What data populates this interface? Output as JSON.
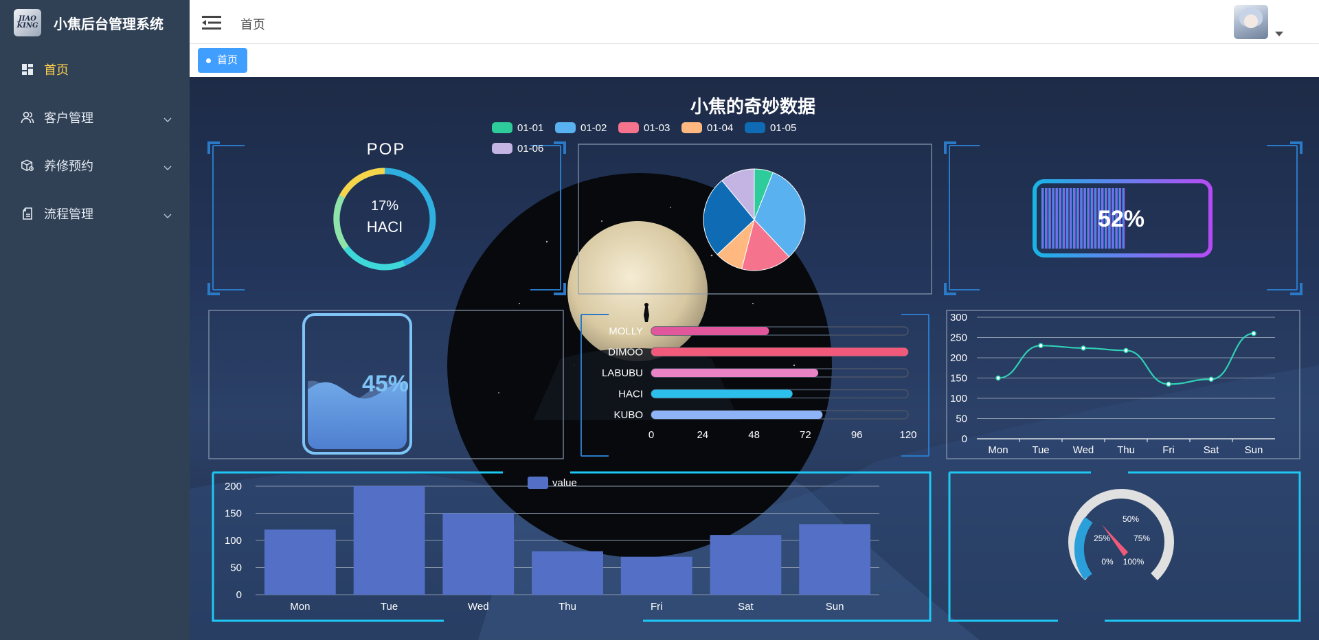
{
  "app": {
    "title": "小焦后台管理系统",
    "logo_text_line1": "JIAO",
    "logo_text_line2": "KING"
  },
  "sidebar": {
    "items": [
      {
        "label": "首页",
        "icon": "dashboard-icon",
        "active": true
      },
      {
        "label": "客户管理",
        "icon": "users-icon",
        "has_submenu": true
      },
      {
        "label": "养修预约",
        "icon": "box-icon",
        "has_submenu": true
      },
      {
        "label": "流程管理",
        "icon": "flow-icon",
        "has_submenu": true
      }
    ]
  },
  "header": {
    "breadcrumb": "首页"
  },
  "tags": [
    {
      "label": "首页",
      "active": true
    }
  ],
  "dashboard": {
    "title": "小焦的奇妙数据",
    "pop": {
      "title": "POP",
      "percent_label": "17%",
      "name": "HACI"
    },
    "battery": {
      "value": 52,
      "label": "52%"
    },
    "liquid": {
      "value": 45,
      "label": "45%"
    },
    "gauge": {
      "value": 20,
      "tick_labels": [
        "0%",
        "25%",
        "50%",
        "75%",
        "100%"
      ]
    }
  },
  "chart_data": [
    {
      "type": "pie",
      "categories": [
        "01-01",
        "01-02",
        "01-03",
        "01-04",
        "01-05",
        "01-06"
      ],
      "values": [
        6,
        32,
        16,
        9,
        26,
        11
      ],
      "colors": [
        "#2ecc9a",
        "#5ab1ef",
        "#f5738c",
        "#ffb980",
        "#0e6bb4",
        "#c4b4e4"
      ],
      "legend": "top"
    },
    {
      "type": "bar",
      "orientation": "horizontal",
      "categories": [
        "MOLLY",
        "DIMOO",
        "LABUBU",
        "HACI",
        "KUBO"
      ],
      "values": [
        55,
        120,
        78,
        66,
        80
      ],
      "colors": [
        "#e1579b",
        "#f25a7c",
        "#ea82c6",
        "#2dbfeb",
        "#8fb3f7"
      ],
      "xlim": [
        0,
        120
      ],
      "xticks": [
        "0",
        "24",
        "48",
        "72",
        "96",
        "120"
      ]
    },
    {
      "type": "line",
      "categories": [
        "Mon",
        "Tue",
        "Wed",
        "Thu",
        "Fri",
        "Sat",
        "Sun"
      ],
      "values": [
        150,
        230,
        224,
        218,
        135,
        147,
        260
      ],
      "ylim": [
        0,
        300
      ],
      "yticks": [
        "0",
        "50",
        "100",
        "150",
        "200",
        "250",
        "300"
      ],
      "color": "#2ed1b5"
    },
    {
      "type": "bar",
      "categories": [
        "Mon",
        "Tue",
        "Wed",
        "Thu",
        "Fri",
        "Sat",
        "Sun"
      ],
      "series": [
        {
          "name": "value",
          "values": [
            120,
            200,
            150,
            80,
            70,
            110,
            130
          ]
        }
      ],
      "ylim": [
        0,
        200
      ],
      "yticks": [
        "0",
        "50",
        "100",
        "150",
        "200"
      ],
      "color": "#5470c6",
      "legend": "top"
    }
  ]
}
